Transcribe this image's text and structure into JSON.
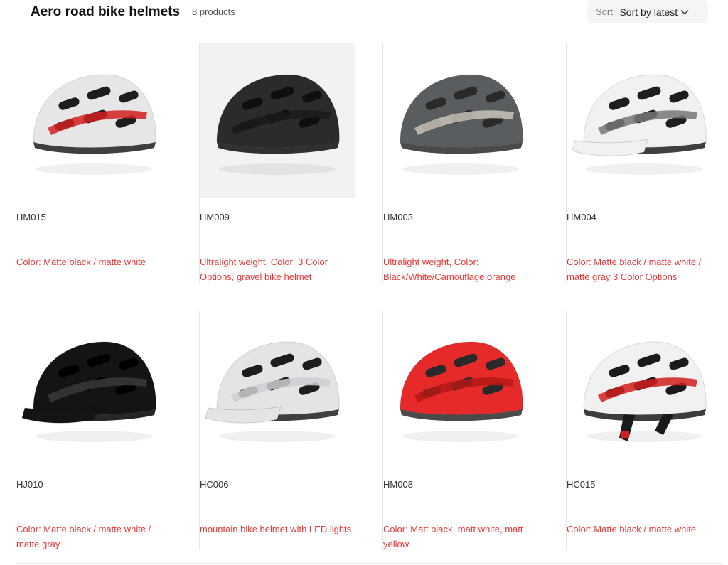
{
  "header": {
    "title": "Aero road bike helmets",
    "count": "8 products",
    "sort_label": "Sort:",
    "sort_value": "Sort by latest"
  },
  "products": [
    {
      "code": "HM015",
      "desc": "Color: Matte black / matte white",
      "shell": "#e6e6e6",
      "accent": "#d21f1f",
      "dark": "#1d1d1d",
      "style": "aero"
    },
    {
      "code": "HM009",
      "desc": "Ultralight weight, Color: 3 Color Options, gravel bike helmet",
      "shell": "#2b2b2b",
      "accent": "#1a1a1a",
      "dark": "#0e0e0e",
      "style": "round"
    },
    {
      "code": "HM003",
      "desc": "Ultralight weight, Color: Black/White/Camouflage orange",
      "shell": "#5a5d60",
      "accent": "#c9c3b8",
      "dark": "#2a2a2a",
      "style": "aero"
    },
    {
      "code": "HM004",
      "desc": "Color: Matte black / matte white / matte gray 3 Color Options",
      "shell": "#f1f1f1",
      "accent": "#777777",
      "dark": "#1d1d1d",
      "style": "visor"
    },
    {
      "code": "HJ010",
      "desc": "Color: Matte black / matte white / matte gray",
      "shell": "#141414",
      "accent": "#3a3a3a",
      "dark": "#000000",
      "style": "visor"
    },
    {
      "code": "HC006",
      "desc": "mountain bike helmet with LED lights",
      "shell": "#e4e4e6",
      "accent": "#cfcfd2",
      "dark": "#1d1d1d",
      "style": "visor"
    },
    {
      "code": "HM008",
      "desc": "Color: Matt black, matt white, matt yellow",
      "shell": "#e62a2a",
      "accent": "#b51818",
      "dark": "#2a2a2a",
      "style": "round"
    },
    {
      "code": "HC015",
      "desc": "Color: Matte black / matte white",
      "shell": "#f1f1f1",
      "accent": "#d21f1f",
      "dark": "#1a1a1a",
      "style": "straps"
    }
  ]
}
